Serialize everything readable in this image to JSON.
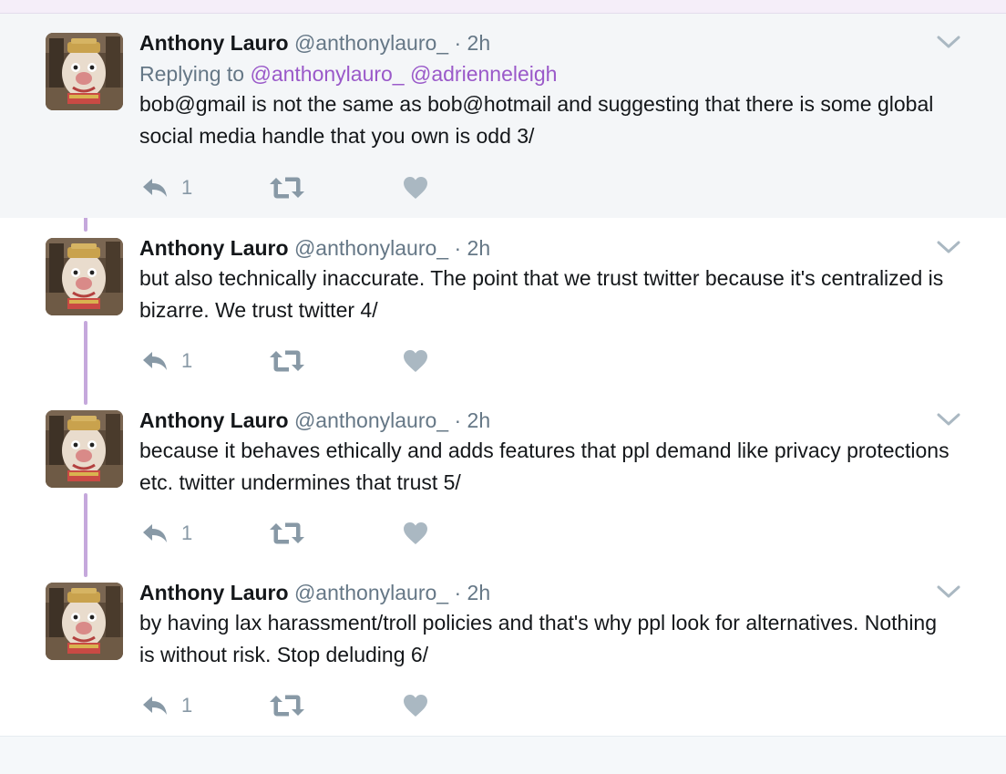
{
  "colors": {
    "link": "#9a59c9",
    "thread_line": "#c5a8dc",
    "muted": "#657786",
    "icon": "#8899a6",
    "highlight_bg": "#f4f6f8"
  },
  "tweets": [
    {
      "name": "Anthony Lauro",
      "handle": "@anthonylauro_",
      "dot": "·",
      "time": "2h",
      "replying_prefix": "Replying to",
      "replying_to": [
        "@anthonylauro_",
        "@adrienneleigh"
      ],
      "text": "bob@gmail is not the same as bob@hotmail and suggesting that there is some global social media handle that you own is odd 3/",
      "reply_count": "1",
      "icons": {
        "reply": "reply-icon",
        "retweet": "retweet-icon",
        "like": "heart-icon",
        "menu": "chevron-down-icon"
      }
    },
    {
      "name": "Anthony Lauro",
      "handle": "@anthonylauro_",
      "dot": "·",
      "time": "2h",
      "text": "but also technically inaccurate. The point that we trust twitter because it's centralized is bizarre. We trust twitter 4/",
      "reply_count": "1",
      "icons": {
        "reply": "reply-icon",
        "retweet": "retweet-icon",
        "like": "heart-icon",
        "menu": "chevron-down-icon"
      }
    },
    {
      "name": "Anthony Lauro",
      "handle": "@anthonylauro_",
      "dot": "·",
      "time": "2h",
      "text": "because it behaves ethically and adds features that ppl demand like privacy protections etc. twitter undermines that trust 5/",
      "reply_count": "1",
      "icons": {
        "reply": "reply-icon",
        "retweet": "retweet-icon",
        "like": "heart-icon",
        "menu": "chevron-down-icon"
      }
    },
    {
      "name": "Anthony Lauro",
      "handle": "@anthonylauro_",
      "dot": "·",
      "time": "2h",
      "text": "by having lax harassment/troll policies and that's why ppl look for alternatives. Nothing is without risk. Stop deluding 6/",
      "reply_count": "1",
      "icons": {
        "reply": "reply-icon",
        "retweet": "retweet-icon",
        "like": "heart-icon",
        "menu": "chevron-down-icon"
      }
    }
  ]
}
